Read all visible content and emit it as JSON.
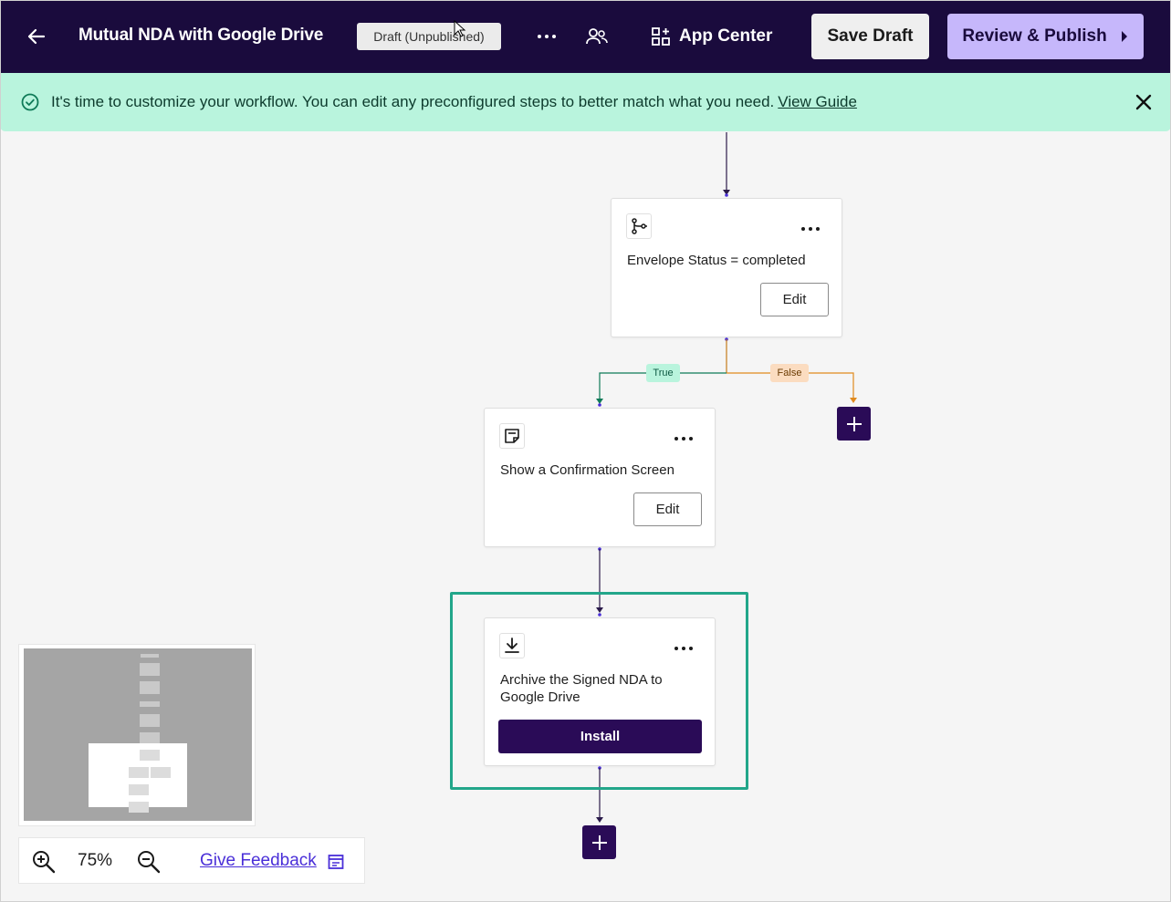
{
  "header": {
    "title": "Mutual NDA with Google Drive",
    "status_badge": "Draft (Unpublished)",
    "app_center_label": "App Center",
    "save_draft_label": "Save Draft",
    "review_publish_label": "Review & Publish"
  },
  "banner": {
    "message": "It's time to customize your workflow. You can edit any preconfigured steps to better match what you need.",
    "link_label": "View Guide"
  },
  "workflow": {
    "steps": [
      {
        "title": "Envelope Status = completed",
        "action_label": "Edit",
        "icon": "branch-icon"
      },
      {
        "title": "Show a Confirmation Screen",
        "action_label": "Edit",
        "icon": "note-icon"
      },
      {
        "title": "Archive the Signed NDA to Google Drive",
        "action_label": "Install",
        "icon": "download-icon"
      }
    ],
    "branches": {
      "true_label": "True",
      "false_label": "False"
    }
  },
  "zoom": {
    "level": "75%",
    "feedback_label": "Give Feedback"
  },
  "colors": {
    "header_bg": "#1a0b3d",
    "accent": "#c6b7fb",
    "banner_bg": "#b9f4dd",
    "highlight": "#22a68a",
    "true_branch": "#0e7a57",
    "false_branch": "#e08a1e",
    "primary_button": "#2a0b57"
  }
}
